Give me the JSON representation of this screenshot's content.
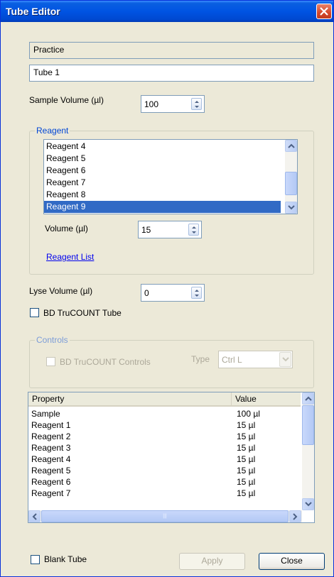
{
  "window": {
    "title": "Tube Editor"
  },
  "experiment_name": "Practice",
  "tube_name": "Tube 1",
  "sample_volume": {
    "label": "Sample Volume (µl)",
    "value": "100"
  },
  "reagent": {
    "group_label": "Reagent",
    "items": [
      "Reagent 4",
      "Reagent 5",
      "Reagent 6",
      "Reagent 7",
      "Reagent 8",
      "Reagent 9"
    ],
    "selected_item": "Reagent 9",
    "volume_label": "Volume (µl)",
    "volume_value": "15",
    "list_link": "Reagent List"
  },
  "lyse_volume": {
    "label": "Lyse Volume (µl)",
    "value": "0"
  },
  "trucount_tube_label": "BD TruCOUNT Tube",
  "controls": {
    "group_label": "Controls",
    "trucount_controls_label": "BD TruCOUNT Controls",
    "type_label": "Type",
    "type_value": "Ctrl L"
  },
  "property_grid": {
    "headers": [
      "Property",
      "Value"
    ],
    "rows": [
      [
        "Sample",
        "100 µl"
      ],
      [
        "Reagent 1",
        "15 µl"
      ],
      [
        "Reagent 2",
        "15 µl"
      ],
      [
        "Reagent 3",
        "15 µl"
      ],
      [
        "Reagent 4",
        "15 µl"
      ],
      [
        "Reagent 5",
        "15 µl"
      ],
      [
        "Reagent 6",
        "15 µl"
      ],
      [
        "Reagent 7",
        "15 µl"
      ]
    ]
  },
  "blank_tube_label": "Blank Tube",
  "buttons": {
    "apply": "Apply",
    "close": "Close"
  }
}
